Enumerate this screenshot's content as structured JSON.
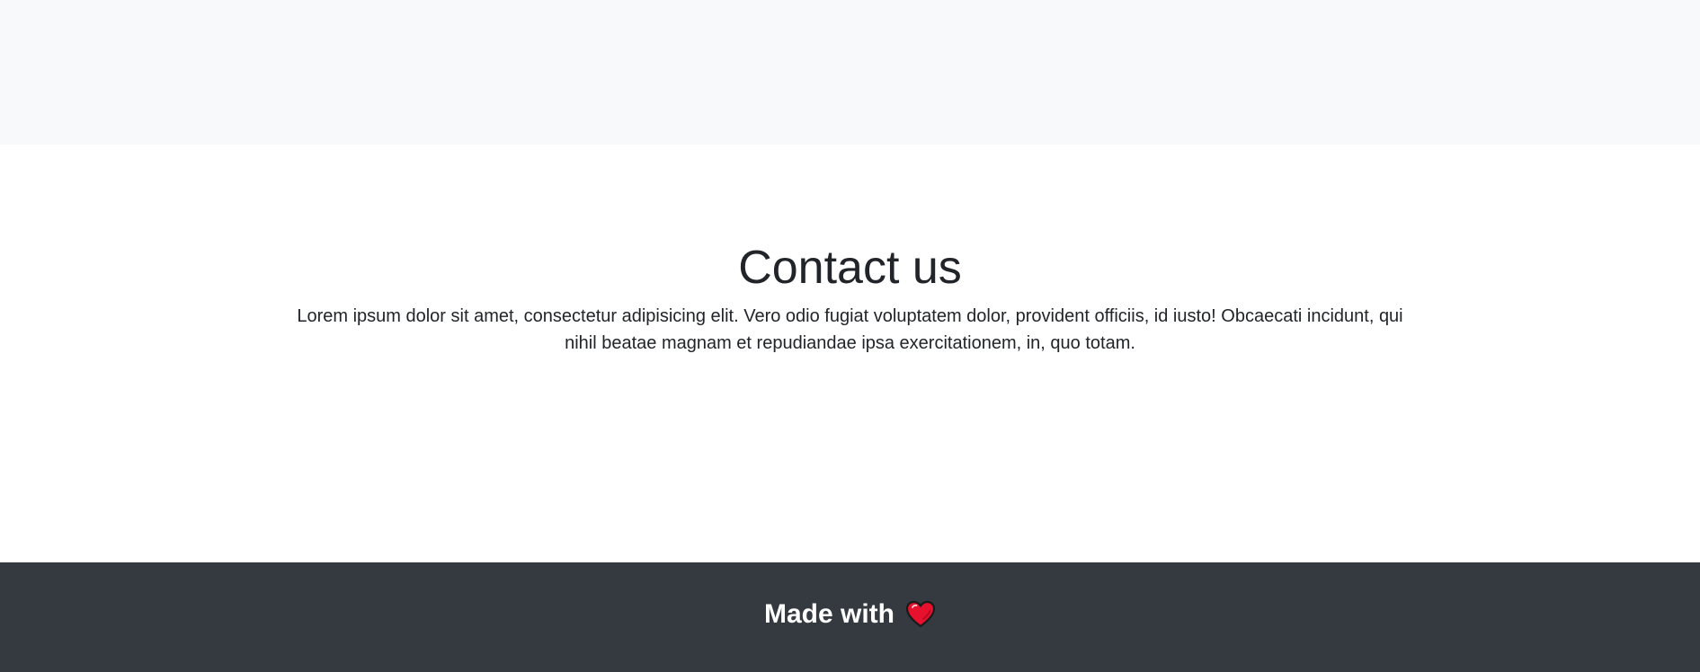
{
  "contact": {
    "title": "Contact us",
    "text": "Lorem ipsum dolor sit amet, consectetur adipisicing elit. Vero odio fugiat voluptatem dolor, provident officiis, id iusto! Obcaecati incidunt, qui nihil beatae magnam et repudiandae ipsa exercitationem, in, quo totam."
  },
  "footer": {
    "text": "Made with",
    "icon": "heart-icon",
    "icon_color": "#e8112d",
    "background": "#343a40"
  },
  "colors": {
    "top_band": "#f8f9fa",
    "text": "#212529"
  }
}
